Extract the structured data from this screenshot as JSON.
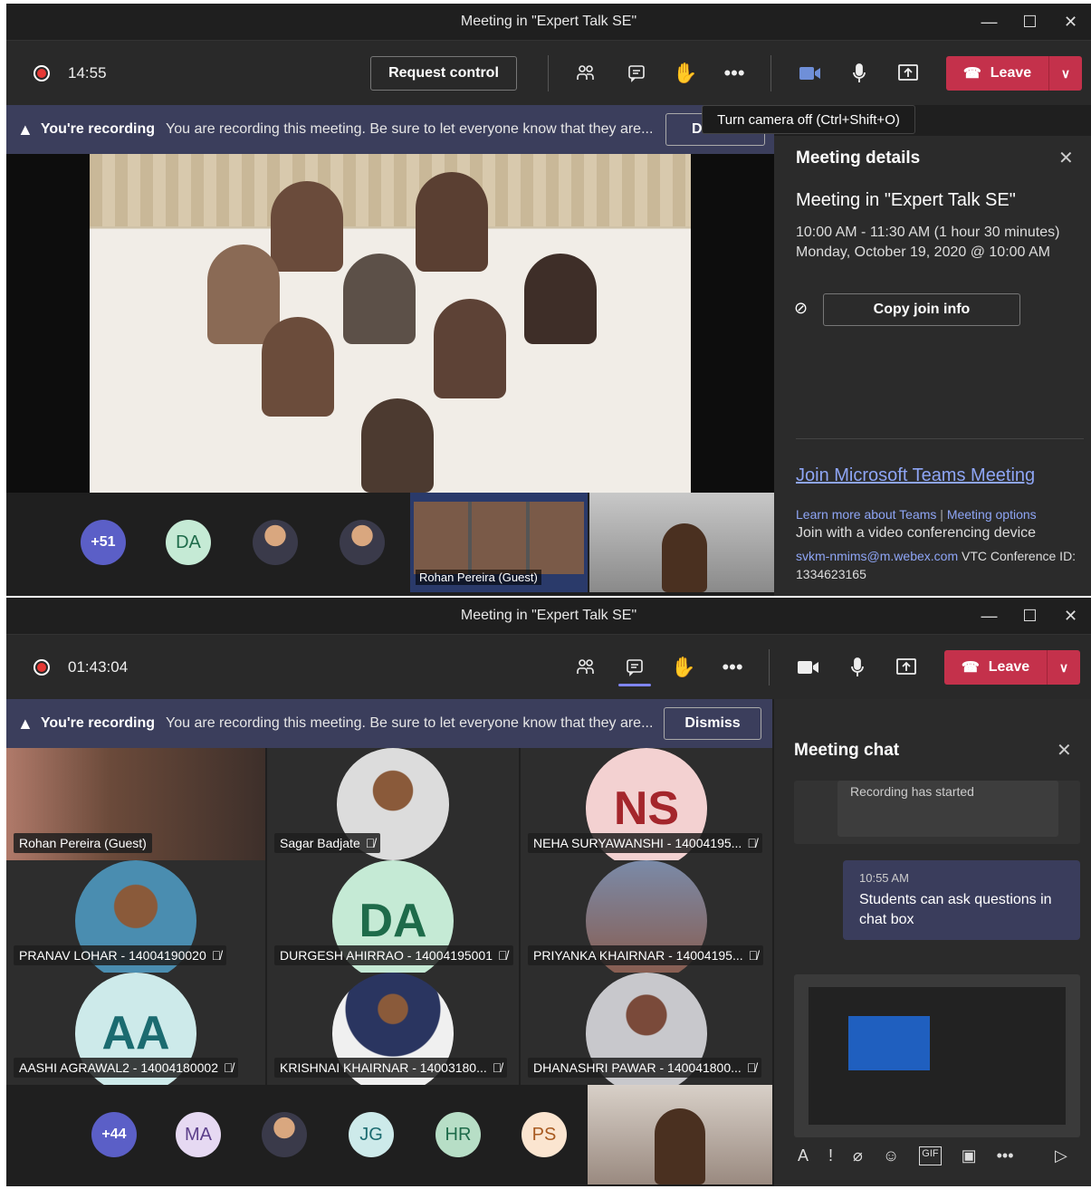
{
  "window1": {
    "title": "Meeting in \"Expert Talk SE\"",
    "timer": "14:55",
    "request_control": "Request control",
    "leave": "Leave",
    "tooltip": "Turn camera off (Ctrl+Shift+O)",
    "banner": {
      "bold": "You're recording",
      "message": "You are recording this meeting. Be sure to let everyone know that they are...",
      "dismiss_partial": "D"
    },
    "details": {
      "header": "Meeting details",
      "title": "Meeting in \"Expert Talk SE\"",
      "time": "10:00 AM - 11:30 AM (1 hour 30 minutes)",
      "date": "Monday, October 19, 2020 @ 10:00 AM",
      "copy_join": "Copy join info",
      "join_link": "Join Microsoft Teams Meeting",
      "learn_more": "Learn more about Teams",
      "meeting_options": "Meeting options",
      "video_device": "Join with a video conferencing device",
      "email": "svkm-nmims@m.webex.com",
      "vtc_label": "VTC Conference ID:",
      "vtc_id": "1334623165"
    },
    "avatars": [
      "+51",
      "DA"
    ],
    "screen_share_name": "Rohan Pereira (Guest)"
  },
  "window2": {
    "title": "Meeting in \"Expert Talk SE\"",
    "timer": "01:43:04",
    "leave": "Leave",
    "banner": {
      "bold": "You're recording",
      "message": "You are recording this meeting. Be sure to let everyone know that they are...",
      "dismiss": "Dismiss"
    },
    "chat": {
      "header": "Meeting chat",
      "system": "Recording has started",
      "msg_time": "10:55 AM",
      "msg_text": "Students can ask questions in chat box"
    },
    "tiles": [
      {
        "name": "Rohan Pereira (Guest)",
        "initials": "",
        "color": "#6b4a3a"
      },
      {
        "name": "Sagar Badjate",
        "initials": "",
        "color": "#8c7a66"
      },
      {
        "name": "NEHA SURYAWANSHI - 14004195...",
        "initials": "NS",
        "color": "#f3d1d1"
      },
      {
        "name": "PRANAV LOHAR - 14004190020",
        "initials": "",
        "color": "#4a8db0"
      },
      {
        "name": "DURGESH AHIRRAO - 14004195001",
        "initials": "DA",
        "color": "#c5ead5"
      },
      {
        "name": "PRIYANKA KHAIRNAR - 14004195...",
        "initials": "",
        "color": "#7a6a8a"
      },
      {
        "name": "AASHI AGRAWAL2 - 14004180002",
        "initials": "AA",
        "color": "#cdeaea"
      },
      {
        "name": "KRISHNAI KHAIRNAR - 14003180...",
        "initials": "",
        "color": "#6a6a7a"
      },
      {
        "name": "DHANASHRI PAWAR - 140041800...",
        "initials": "",
        "color": "#9a8a8a"
      }
    ],
    "avatars": [
      "+44",
      "MA",
      "JG",
      "HR",
      "PS"
    ]
  }
}
